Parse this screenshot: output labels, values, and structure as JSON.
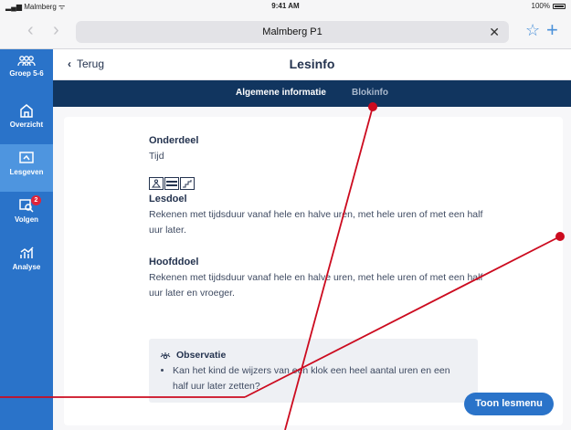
{
  "status": {
    "carrier": "Malmberg",
    "time": "9:41 AM",
    "battery": "100%"
  },
  "browser": {
    "url": "Malmberg P1",
    "clear_icon": "close-icon",
    "bookmark_icon": "star-icon",
    "new_tab_icon": "plus-icon"
  },
  "sidebar": {
    "items": [
      {
        "label": "Groep 5-6",
        "icon": "group-icon"
      },
      {
        "label": "Overzicht",
        "icon": "home-icon"
      },
      {
        "label": "Lesgeven",
        "icon": "board-icon"
      },
      {
        "label": "Volgen",
        "icon": "search-icon",
        "badge": "2"
      },
      {
        "label": "Analyse",
        "icon": "chart-icon"
      }
    ],
    "active": "Lesgeven"
  },
  "header": {
    "back_label": "Terug",
    "title": "Lesinfo"
  },
  "tabs": {
    "algemene": "Algemene informatie",
    "blokinfo": "Blokinfo"
  },
  "content": {
    "onderdeel_heading": "Onderdeel",
    "onderdeel_value": "Tijd",
    "lesdoel_heading": "Lesdoel",
    "lesdoel_text": "Rekenen met tijdsduur vanaf hele en halve uren, met hele uren of met een half uur later.",
    "hoofddoel_heading": "Hoofddoel",
    "hoofddoel_text": "Rekenen met tijdsduur vanaf hele en halve uren, met hele uren of met een half uur later en vroeger.",
    "observatie_heading": "Observatie",
    "observatie_item": "Kan het kind de wijzers van een klok een heel aantal uren en een half uur later zetten?"
  },
  "buttons": {
    "toon_lesmenu": "Toon lesmenu"
  },
  "colors": {
    "sidebar": "#2a73c9",
    "tabbar": "#11355f",
    "annotation": "#cc0b1f"
  }
}
